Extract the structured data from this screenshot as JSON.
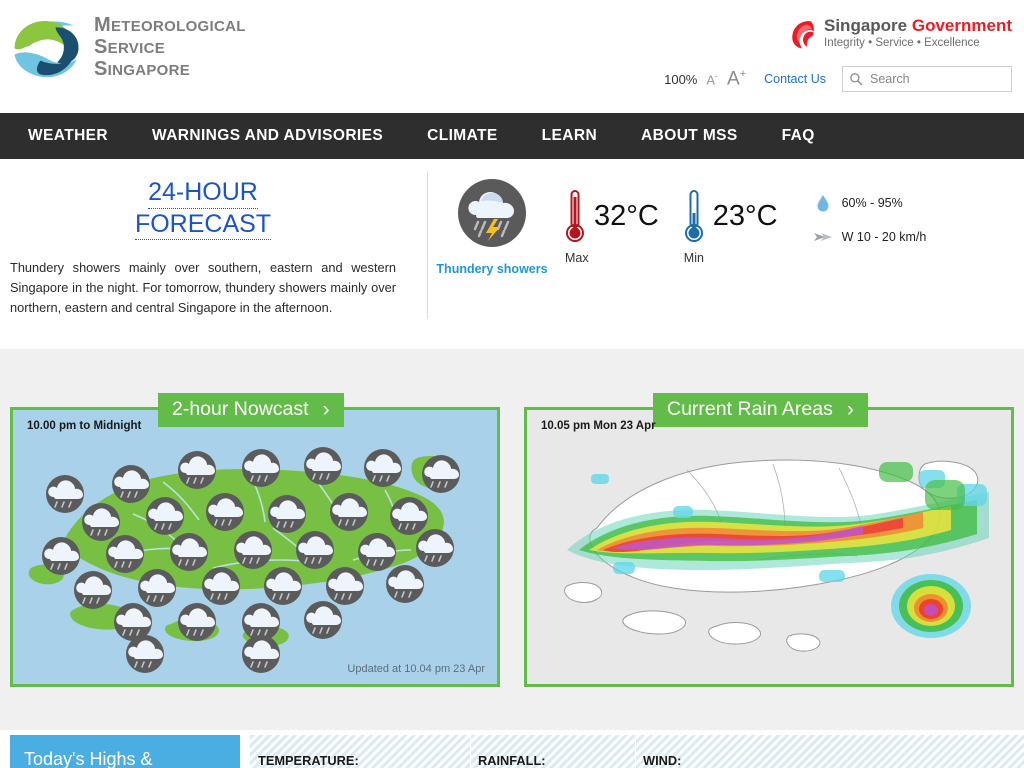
{
  "site": {
    "logo_lines": [
      {
        "cap": "M",
        "rest": "ETEOROLOGICAL"
      },
      {
        "cap": "S",
        "rest": "ERVICE"
      },
      {
        "cap": "S",
        "rest": "INGAPORE"
      }
    ],
    "logo_icon": "mss-globe-logo-icon"
  },
  "gov_banner": {
    "lion_icon": "singapore-lion-head-icon",
    "title_primary": "Singapore ",
    "title_accent": "Government",
    "tagline": "Integrity • Service • Excellence",
    "accent_color": "#ed1c24"
  },
  "utility": {
    "zoom_level": "100%",
    "decrease_font": "A",
    "decrease_font_sup": "-",
    "increase_font": "A",
    "increase_font_sup": "+",
    "contact_label": "Contact Us",
    "search_placeholder": "Search",
    "search_value": "",
    "search_icon": "magnifier-icon"
  },
  "nav": {
    "items": [
      {
        "label": "WEATHER"
      },
      {
        "label": "WARNINGS AND ADVISORIES"
      },
      {
        "label": "CLIMATE"
      },
      {
        "label": "LEARN"
      },
      {
        "label": "ABOUT MSS"
      },
      {
        "label": "FAQ"
      }
    ]
  },
  "forecast": {
    "title_line1": "24-HOUR",
    "title_line2": "FORECAST",
    "title_color": "#1a55c7",
    "description": "Thundery showers mainly over southern, eastern and western Singapore in the night. For tomorrow, thundery showers mainly over northern, eastern and central Singapore in the afternoon.",
    "condition": {
      "icon": "thundery-showers-icon",
      "label": "Thundery showers",
      "label_color": "#2196d6"
    },
    "max": {
      "icon": "thermometer-red-icon",
      "value": "32°C",
      "caption": "Max",
      "color": "#b3161c"
    },
    "min": {
      "icon": "thermometer-blue-icon",
      "value": "23°C",
      "caption": "Min",
      "color": "#1f6ca8"
    },
    "humidity": {
      "icon": "water-droplet-icon",
      "text": "60% - 95%"
    },
    "wind": {
      "icon": "wind-arrow-icon",
      "text": "W 10 - 20 km/h"
    }
  },
  "maps": {
    "nowcast": {
      "tab_label": "2-hour Nowcast",
      "tab_chevron": "›",
      "time_range": "10.00 pm to Midnight",
      "updated": "Updated at 10.04 pm 23 Apr",
      "border_color": "#63bb49",
      "land_color": "#78c043",
      "sea_color": "#a9d2ea",
      "icon_bubble_color": "#5b5b5b"
    },
    "radar": {
      "tab_label": "Current Rain Areas",
      "tab_chevron": "›",
      "timestamp": "10.05 pm Mon 23 Apr",
      "border_color": "#63bb49",
      "background_color": "#e8e8e8",
      "land_color": "#ffffff"
    }
  },
  "bottom_strip": {
    "panel_title": "Today's Highs &",
    "columns": [
      {
        "label": "TEMPERATURE:"
      },
      {
        "label": "RAINFALL:"
      },
      {
        "label": "WIND:"
      }
    ]
  }
}
